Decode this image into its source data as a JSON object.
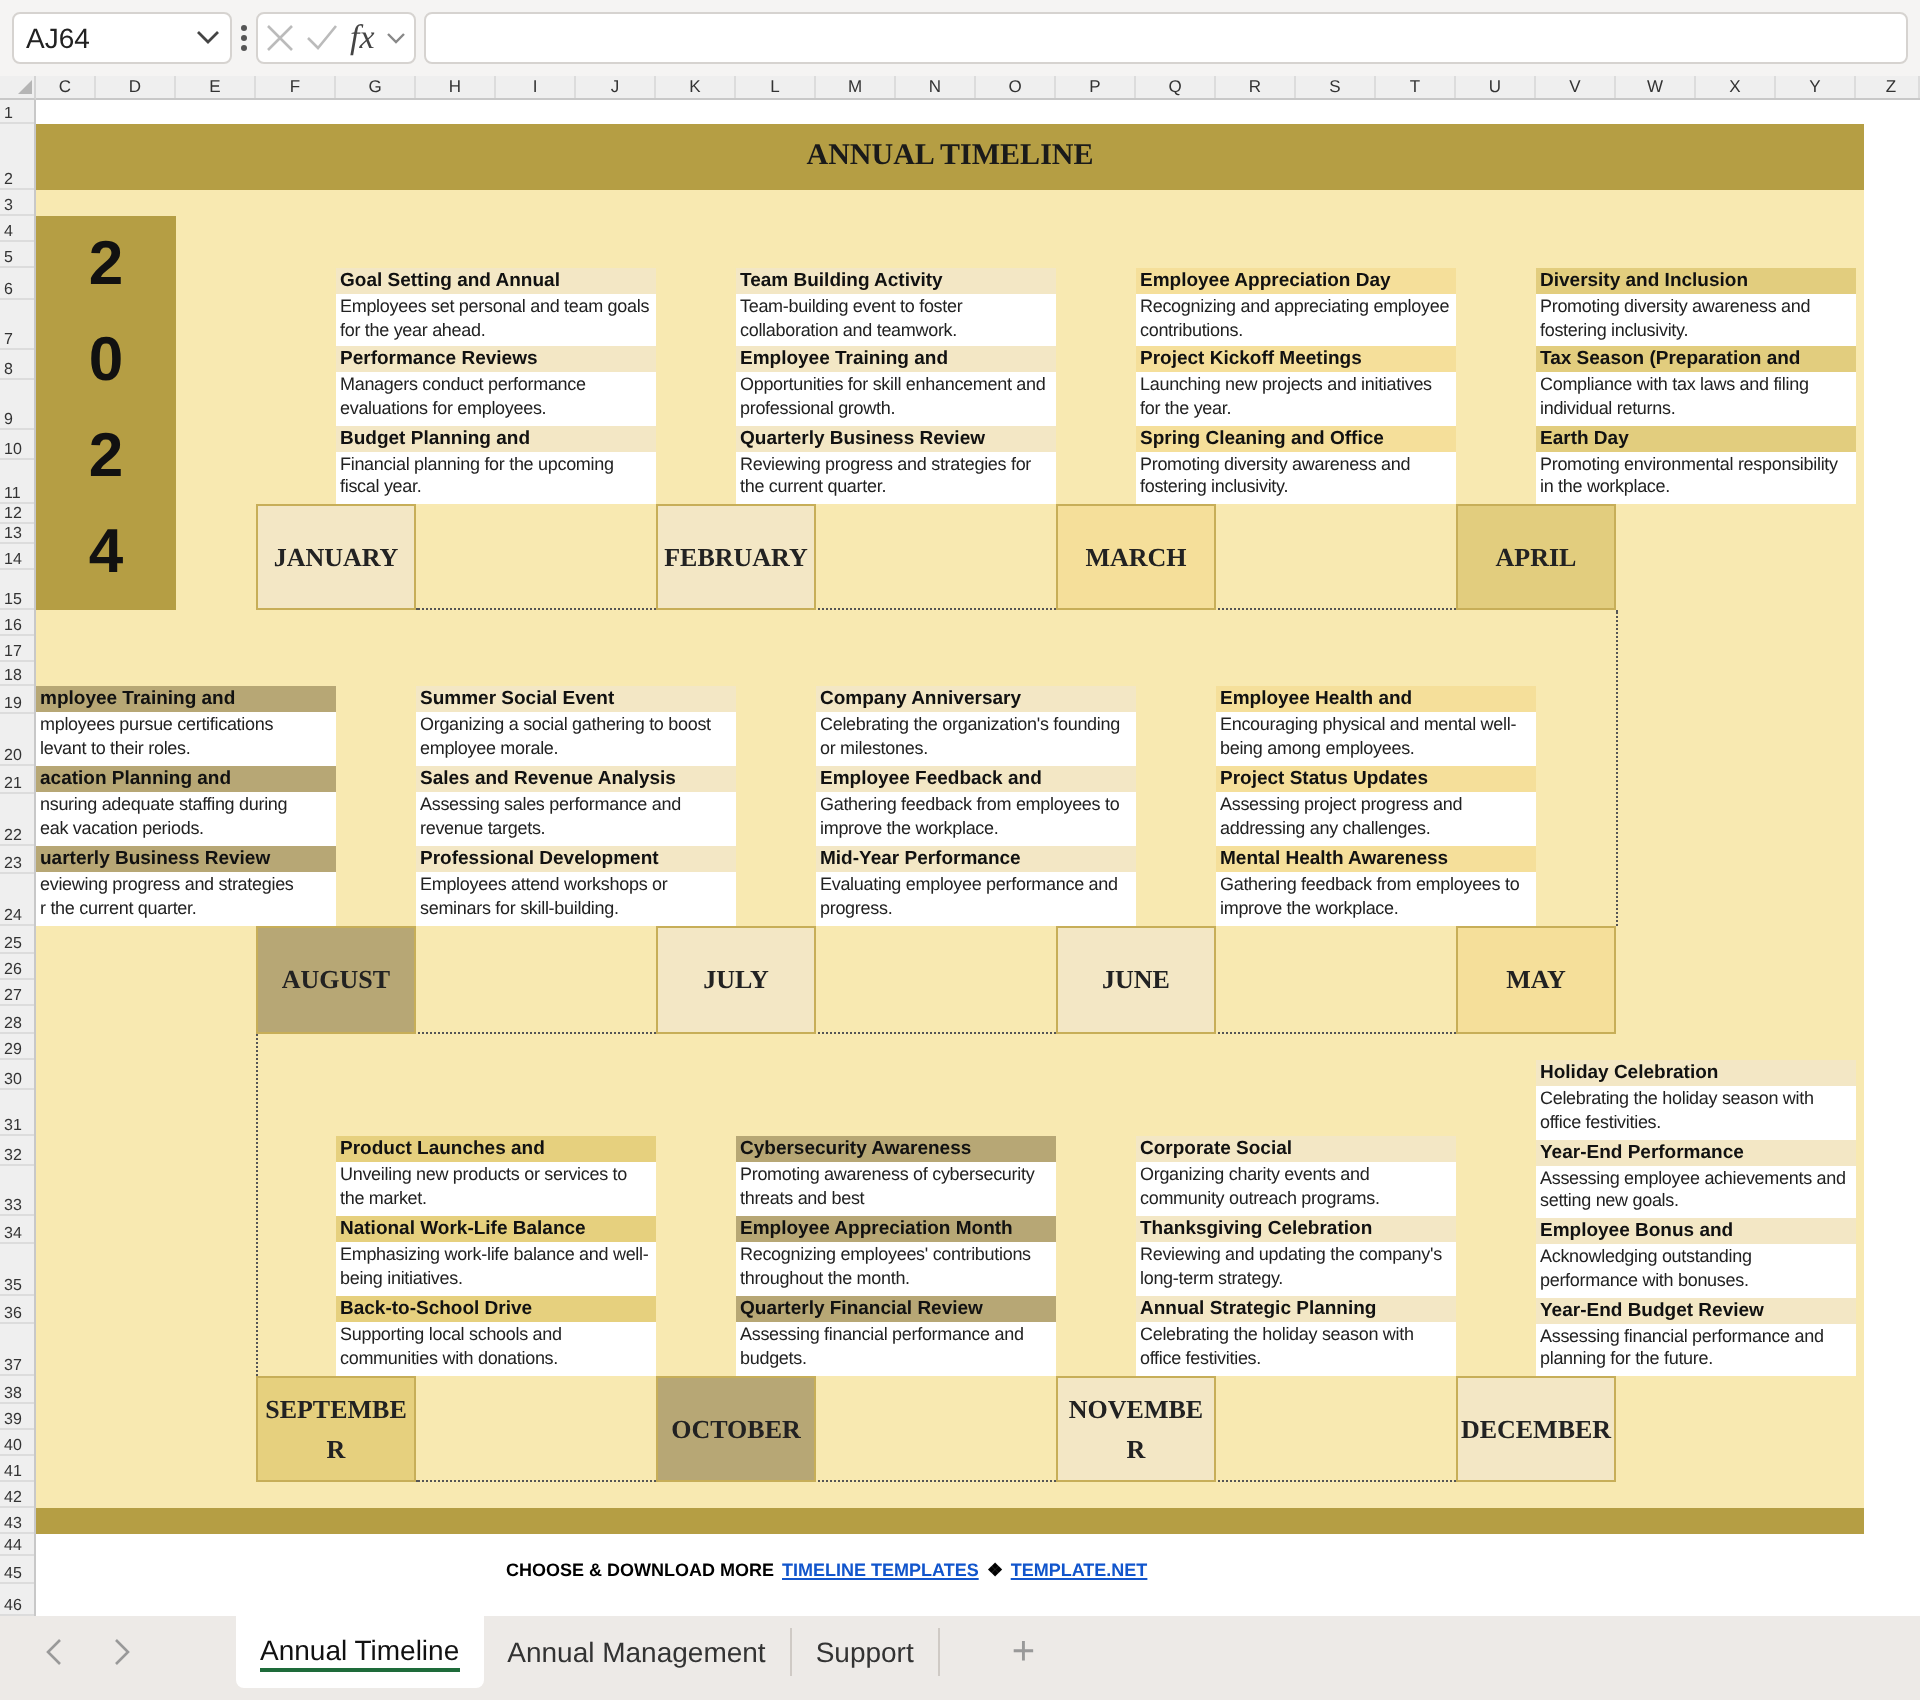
{
  "formula_bar": {
    "name_box": "AJ64",
    "function_label": "fx"
  },
  "column_headers": [
    "C",
    "D",
    "E",
    "F",
    "G",
    "H",
    "I",
    "J",
    "K",
    "L",
    "M",
    "N",
    "O",
    "P",
    "Q",
    "R",
    "S",
    "T",
    "U",
    "V",
    "W",
    "X",
    "Y",
    "Z"
  ],
  "row_headers": [
    "1",
    "2",
    "3",
    "4",
    "5",
    "6",
    "7",
    "8",
    "9",
    "10",
    "11",
    "12",
    "13",
    "14",
    "15",
    "16",
    "17",
    "18",
    "19",
    "20",
    "21",
    "22",
    "23",
    "24",
    "25",
    "26",
    "27",
    "28",
    "29",
    "30",
    "31",
    "32",
    "33",
    "34",
    "35",
    "36",
    "37",
    "38",
    "39",
    "40",
    "41",
    "42",
    "43",
    "44",
    "45",
    "46"
  ],
  "sheet": {
    "title": "ANNUAL TIMELINE",
    "year": "2024",
    "months": [
      {
        "name": "JANUARY",
        "color": "#f3e7c5",
        "events": [
          {
            "title": "Goal Setting and Annual",
            "description": "Employees set personal and team goals for the year ahead."
          },
          {
            "title": "Performance Reviews",
            "description": "Managers conduct performance evaluations for employees."
          },
          {
            "title": "Budget Planning and",
            "description": "Financial planning for the upcoming fiscal year."
          }
        ]
      },
      {
        "name": "FEBRUARY",
        "color": "#f3e7c5",
        "events": [
          {
            "title": "Team Building Activity",
            "description": "Team-building event to foster collaboration and teamwork."
          },
          {
            "title": "Employee Training and",
            "description": "Opportunities for skill enhancement and professional growth."
          },
          {
            "title": "Quarterly Business Review",
            "description": "Reviewing progress and strategies for the current quarter."
          }
        ]
      },
      {
        "name": "MARCH",
        "color": "#f5df9a",
        "events": [
          {
            "title": "Employee Appreciation Day",
            "description": "Recognizing and appreciating employee contributions."
          },
          {
            "title": "Project Kickoff Meetings",
            "description": "Launching new projects and initiatives for the year."
          },
          {
            "title": "Spring Cleaning and Office",
            "description": "Promoting diversity awareness and fostering inclusivity."
          }
        ]
      },
      {
        "name": "APRIL",
        "color": "#e2cd7e",
        "events": [
          {
            "title": "Diversity and Inclusion",
            "description": "Promoting diversity awareness and fostering inclusivity."
          },
          {
            "title": "Tax Season (Preparation and",
            "description": "Compliance with tax laws and filing individual returns."
          },
          {
            "title": "Earth Day",
            "description": "Promoting environmental responsibility in the workplace."
          }
        ]
      },
      {
        "name": "AUGUST",
        "color": "#b7a775",
        "events": [
          {
            "title": "mployee Training and",
            "description": "mployees pursue certifications\nlevant to their roles."
          },
          {
            "title": "acation Planning and",
            "description": "nsuring adequate staffing during\neak vacation periods."
          },
          {
            "title": "uarterly Business Review",
            "description": "eviewing progress and strategies\nr the current quarter."
          }
        ]
      },
      {
        "name": "JULY",
        "color": "#f3e7c5",
        "events": [
          {
            "title": "Summer Social Event",
            "description": "Organizing a social gathering to boost employee morale."
          },
          {
            "title": "Sales and Revenue Analysis",
            "description": "Assessing sales performance and revenue targets."
          },
          {
            "title": "Professional Development",
            "description": "Employees attend workshops or seminars for skill-building."
          }
        ]
      },
      {
        "name": "JUNE",
        "color": "#f3e7c5",
        "events": [
          {
            "title": "Company Anniversary",
            "description": "Celebrating the organization's founding or milestones."
          },
          {
            "title": "Employee Feedback and",
            "description": "Gathering feedback from employees to improve the workplace."
          },
          {
            "title": "Mid-Year Performance",
            "description": "Evaluating employee performance and progress."
          }
        ]
      },
      {
        "name": "MAY",
        "color": "#f5df9a",
        "events": [
          {
            "title": "Employee Health and",
            "description": "Encouraging physical and mental well-being among employees."
          },
          {
            "title": "Project Status Updates",
            "description": "Assessing project progress and addressing any challenges."
          },
          {
            "title": "Mental Health Awareness",
            "description": "Gathering feedback from employees to improve the workplace."
          }
        ]
      },
      {
        "name": "SEPTEMBER",
        "color": "#e6d07e",
        "events": [
          {
            "title": "Product Launches and",
            "description": "Unveiling new products or services to the market."
          },
          {
            "title": "National Work-Life Balance",
            "description": "Emphasizing work-life balance and well-being initiatives."
          },
          {
            "title": "Back-to-School Drive",
            "description": "Supporting local schools and communities with donations."
          }
        ]
      },
      {
        "name": "OCTOBER",
        "color": "#b7a775",
        "events": [
          {
            "title": "Cybersecurity Awareness",
            "description": "Promoting awareness of cybersecurity threats and best"
          },
          {
            "title": "Employee Appreciation Month",
            "description": "Recognizing employees' contributions throughout the month."
          },
          {
            "title": "Quarterly Financial Review",
            "description": "Assessing financial performance and budgets."
          }
        ]
      },
      {
        "name": "NOVEMBER",
        "color": "#f3e7c5",
        "events": [
          {
            "title": "Corporate Social",
            "description": "Organizing charity events and community outreach programs."
          },
          {
            "title": "Thanksgiving Celebration",
            "description": "Reviewing and updating the company's long-term strategy."
          },
          {
            "title": "Annual Strategic Planning",
            "description": "Celebrating the holiday season with office festivities."
          }
        ]
      },
      {
        "name": "DECEMBER",
        "color": "#f3e7c5",
        "events": [
          {
            "title": "Holiday Celebration",
            "description": "Celebrating the holiday season with office festivities."
          },
          {
            "title": "Year-End Performance",
            "description": "Assessing employee achievements and setting new goals."
          },
          {
            "title": "Employee Bonus and",
            "description": "Acknowledging outstanding performance with bonuses."
          },
          {
            "title": "Year-End Budget Review",
            "description": "Assessing financial performance and planning for the future."
          }
        ]
      }
    ],
    "footer": {
      "text": "CHOOSE & DOWNLOAD MORE",
      "link": "TIMELINE TEMPLATES",
      "separator": "❖",
      "site": "TEMPLATE.NET"
    }
  },
  "sheet_tabs": [
    {
      "label": "Annual Timeline",
      "selected": true
    },
    {
      "label": "Annual Management",
      "selected": false
    },
    {
      "label": "Support",
      "selected": false
    }
  ],
  "add_tab": "+"
}
